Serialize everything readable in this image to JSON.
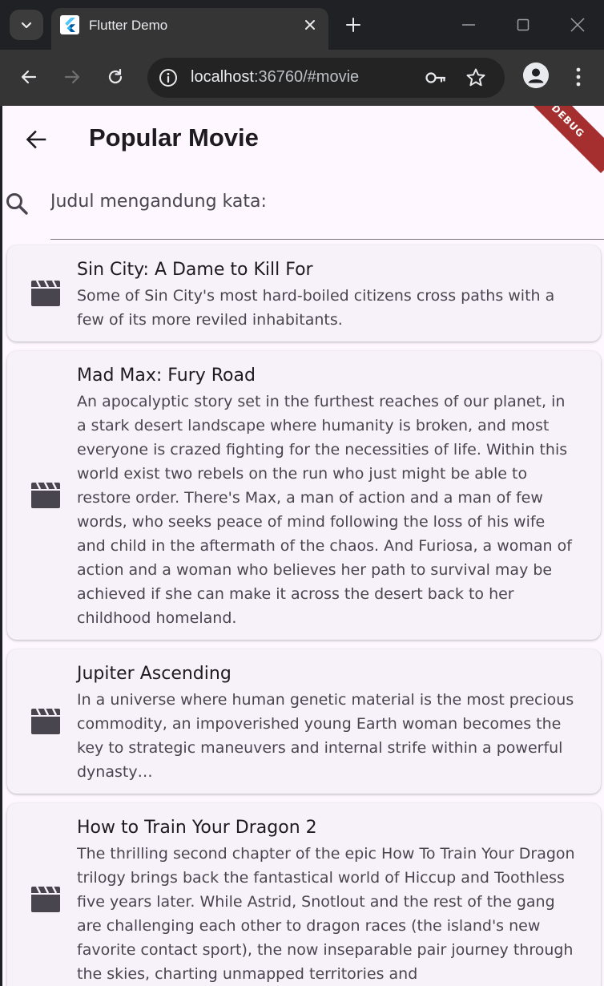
{
  "browser": {
    "tab_title": "Flutter Demo",
    "url_host": "localhost",
    "url_rest": ":36760/#movie"
  },
  "app": {
    "title": "Popular Movie",
    "debug_label": "DEBUG",
    "search": {
      "placeholder": "Judul mengandung kata:",
      "value": ""
    },
    "movies": [
      {
        "title": "Sin City: A Dame to Kill For",
        "overview": "Some of Sin City's most hard-boiled citizens cross paths with a few of its more reviled inhabitants."
      },
      {
        "title": "Mad Max: Fury Road",
        "overview": "An apocalyptic story set in the furthest reaches of our planet, in a stark desert landscape where humanity is broken, and most everyone is crazed fighting for the necessities of life. Within this world exist two rebels on the run who just might be able to restore order. There's Max, a man of action and a man of few words, who seeks peace of mind following the loss of his wife and child in the aftermath of the chaos. And Furiosa, a woman of action and a woman who believes her path to survival may be achieved if she can make it across the desert back to her childhood homeland."
      },
      {
        "title": "Jupiter Ascending",
        "overview": "In a universe where human genetic material is the most precious commodity, an impoverished young Earth woman becomes the key to strategic maneuvers and internal strife within a powerful dynasty…"
      },
      {
        "title": "How to Train Your Dragon 2",
        "overview": "The thrilling second chapter of the epic How To Train Your Dragon trilogy brings back the fantastical world of Hiccup and Toothless five years later. While Astrid, Snotlout and the rest of the gang are challenging each other to dragon races (the island's new favorite contact sport), the now inseparable pair journey through the skies, charting unmapped territories and"
      }
    ]
  }
}
